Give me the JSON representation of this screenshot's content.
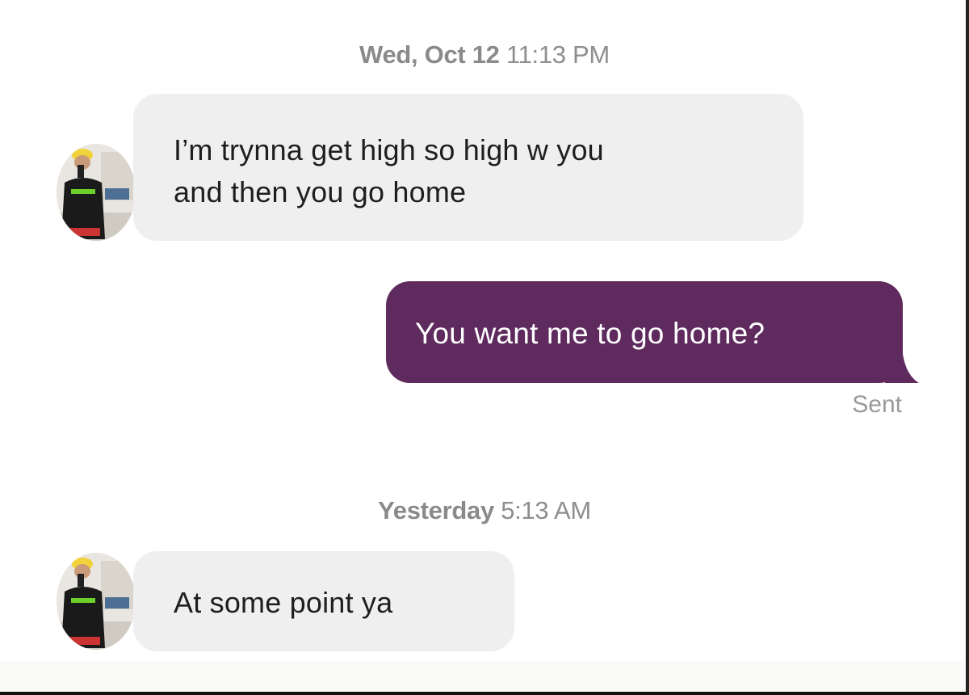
{
  "conversation": {
    "groups": [
      {
        "timestamp_day": "Wed, Oct 12",
        "timestamp_time": "11:13 PM"
      },
      {
        "timestamp_day": "Yesterday",
        "timestamp_time": "5:13 AM"
      }
    ],
    "messages": [
      {
        "direction": "incoming",
        "line1": "I’m trynna get high so high w you",
        "line2": "and then you go home"
      },
      {
        "direction": "outgoing",
        "text": "You want me to go home?",
        "status": "Sent"
      },
      {
        "direction": "incoming",
        "text": "At some point ya"
      }
    ]
  },
  "colors": {
    "incoming_bubble": "#efefef",
    "outgoing_bubble": "#5f2a5e",
    "timestamp_text": "#8e8e8e",
    "status_text": "#9a9a9a"
  },
  "icons": {
    "contact_avatar": "avatar-photo"
  }
}
